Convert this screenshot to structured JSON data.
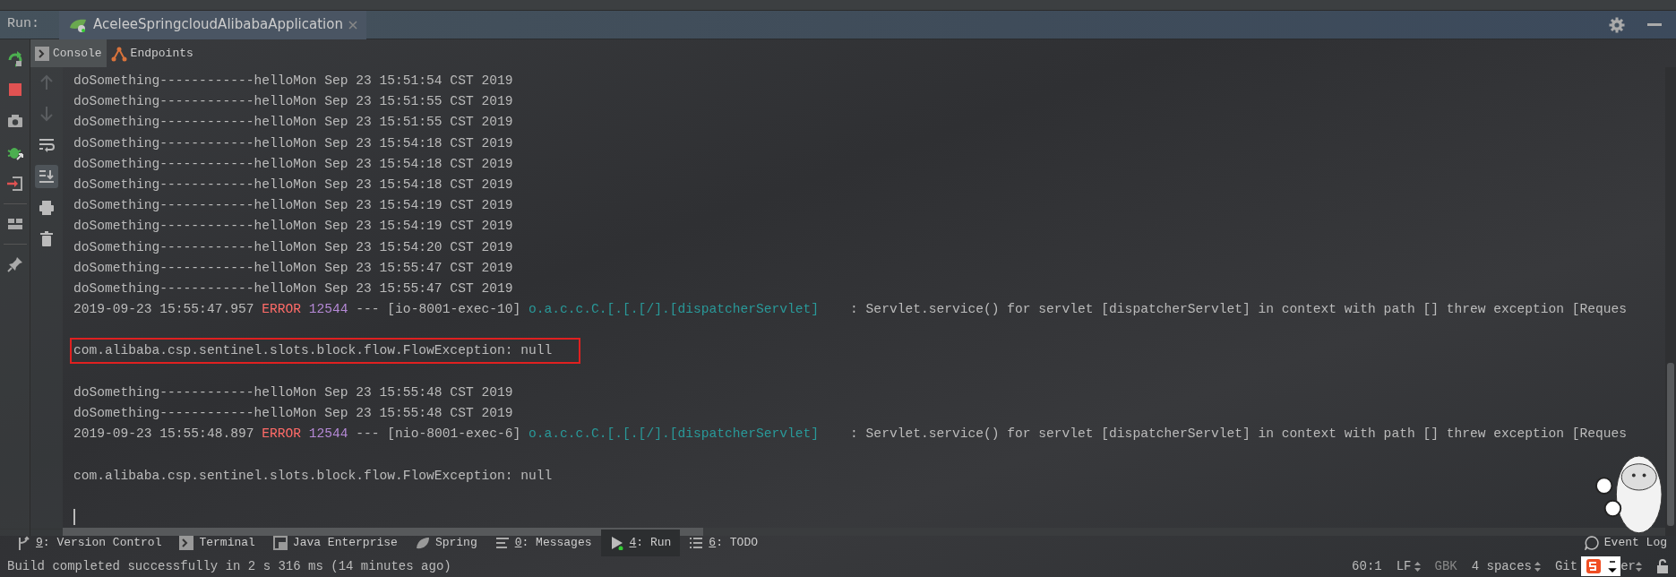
{
  "run_bar": {
    "label": "Run:",
    "config_tab": {
      "title": "AceleeSpringcloudAlibabaApplication"
    }
  },
  "console_tabs": [
    {
      "label": "Console",
      "selected": true
    },
    {
      "label": "Endpoints",
      "selected": false
    }
  ],
  "console_tools": [
    {
      "disabled": true,
      "selected": false
    },
    {
      "disabled": true,
      "selected": false
    },
    {
      "disabled": false,
      "selected": false
    },
    {
      "disabled": false,
      "selected": true
    },
    {
      "disabled": false,
      "selected": false
    },
    {
      "disabled": false,
      "selected": false
    }
  ],
  "console_lines": [
    {
      "kind": "plain",
      "text": "doSomething------------helloMon Sep 23 15:51:54 CST 2019"
    },
    {
      "kind": "plain",
      "text": "doSomething------------helloMon Sep 23 15:51:55 CST 2019"
    },
    {
      "kind": "plain",
      "text": "doSomething------------helloMon Sep 23 15:51:55 CST 2019"
    },
    {
      "kind": "plain",
      "text": "doSomething------------helloMon Sep 23 15:54:18 CST 2019"
    },
    {
      "kind": "plain",
      "text": "doSomething------------helloMon Sep 23 15:54:18 CST 2019"
    },
    {
      "kind": "plain",
      "text": "doSomething------------helloMon Sep 23 15:54:18 CST 2019"
    },
    {
      "kind": "plain",
      "text": "doSomething------------helloMon Sep 23 15:54:19 CST 2019"
    },
    {
      "kind": "plain",
      "text": "doSomething------------helloMon Sep 23 15:54:19 CST 2019"
    },
    {
      "kind": "plain",
      "text": "doSomething------------helloMon Sep 23 15:54:20 CST 2019"
    },
    {
      "kind": "plain",
      "text": "doSomething------------helloMon Sep 23 15:55:47 CST 2019"
    },
    {
      "kind": "plain",
      "text": "doSomething------------helloMon Sep 23 15:55:47 CST 2019"
    },
    {
      "kind": "log",
      "date": "2019-09-23 15:55:47.957",
      "level": "ERROR",
      "pid": "12544",
      "thread": "--- [io-8001-exec-10]",
      "logger": "o.a.c.c.C.[.[.[/].[dispatcherServlet]",
      "message": "   : Servlet.service() for servlet [dispatcherServlet] in context with path [] threw exception [Reques"
    },
    {
      "kind": "blank"
    },
    {
      "kind": "plain",
      "text": "com.alibaba.csp.sentinel.slots.block.flow.FlowException: null",
      "highlighted": true
    },
    {
      "kind": "blank"
    },
    {
      "kind": "plain",
      "text": "doSomething------------helloMon Sep 23 15:55:48 CST 2019"
    },
    {
      "kind": "plain",
      "text": "doSomething------------helloMon Sep 23 15:55:48 CST 2019"
    },
    {
      "kind": "log",
      "date": "2019-09-23 15:55:48.897",
      "level": "ERROR",
      "pid": "12544",
      "thread": "--- [nio-8001-exec-6]",
      "logger": "o.a.c.c.C.[.[.[/].[dispatcherServlet]",
      "message": "   : Servlet.service() for servlet [dispatcherServlet] in context with path [] threw exception [Reques"
    },
    {
      "kind": "blank"
    },
    {
      "kind": "plain",
      "text": "com.alibaba.csp.sentinel.slots.block.flow.FlowException: null",
      "highlighted": false
    },
    {
      "kind": "blank"
    },
    {
      "kind": "cursor"
    }
  ],
  "tool_windows": [
    {
      "label": "9: Version Control",
      "mnemonic": true,
      "selected": false
    },
    {
      "label": "Terminal",
      "mnemonic": false,
      "selected": false
    },
    {
      "label": "Java Enterprise",
      "mnemonic": false,
      "selected": false
    },
    {
      "label": "Spring",
      "mnemonic": false,
      "selected": false
    },
    {
      "label": "0: Messages",
      "mnemonic": true,
      "selected": false
    },
    {
      "label": "4: Run",
      "mnemonic": true,
      "selected": true
    },
    {
      "label": "6: TODO",
      "mnemonic": true,
      "selected": false
    }
  ],
  "event_log": "Event Log",
  "status_bar": {
    "message": "Build completed successfully in 2 s 316 ms (14 minutes ago)",
    "position": "60:1",
    "line_separator": "LF",
    "encoding": "GBK",
    "indent": "4 spaces",
    "git_start": "Git",
    "git_end": "er"
  }
}
